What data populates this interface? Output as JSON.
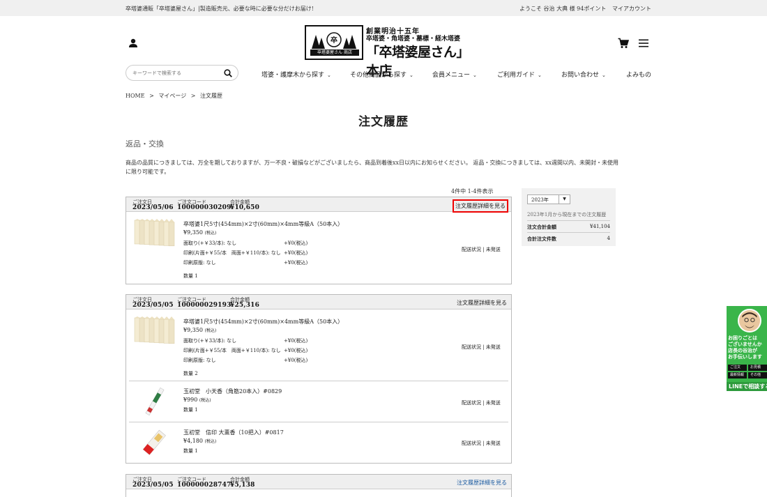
{
  "topbar": {
    "message": "卒塔婆通販「卒塔婆屋さん」|製造販売元、必要な時に必要な分だけお届け!",
    "welcome": "ようこそ 谷治 大典 様 94ポイント",
    "my_account": "マイアカウント"
  },
  "logo": {
    "seal_band": "卒塔婆屋さん 商店",
    "line1": "創業明治十五年",
    "line2": "卒塔婆・角塔婆・墓標・経木塔婆",
    "line3": "「卒塔婆屋さん」本店"
  },
  "icons": {
    "user": "user-icon",
    "cart": "cart-icon",
    "menu": "menu-icon",
    "search": "search-icon"
  },
  "search": {
    "placeholder": "キーワードで検索する"
  },
  "nav": [
    {
      "label": "塔婆・護摩木から探す",
      "chevron": "⌄"
    },
    {
      "label": "その他商品から探す",
      "chevron": "⌄"
    },
    {
      "label": "会員メニュー",
      "chevron": "⌄"
    },
    {
      "label": "ご利用ガイド",
      "chevron": "⌄"
    },
    {
      "label": "お問い合わせ",
      "chevron": "⌄"
    },
    {
      "label": "よみもの"
    }
  ],
  "breadcrumb": {
    "items": [
      "HOME",
      "マイページ",
      "注文履歴"
    ],
    "sep": ">"
  },
  "page_title": "注文履歴",
  "section_title": "返品・交換",
  "notice": "商品の品質につきましては、万全を期しておりますが、万一不良・破損などがございましたら、商品到着後xx日以内にお知らせください。 返品・交換につきましては、xx週間以内、未開封・未使用に限り可能です。",
  "count_text": "4件中 1-4件表示",
  "labels": {
    "order_date": "ご注文日",
    "order_code": "ご注文コード",
    "total": "合計金額",
    "detail_link": "注文履歴詳細を見る",
    "ship_status": "配送状況 | 未発送"
  },
  "orders": [
    {
      "date": "2023/05/06",
      "code": "100000030209",
      "total": "¥10,650",
      "items": [
        {
          "name": "卒塔婆1尺5寸(454mm)×2寸(60mm)×4mm等級A（50本入）",
          "price": "¥9,350",
          "tax": "(税込)",
          "options": [
            {
              "label": "面取り(+￥33/本): なし",
              "value": "+¥0(税込)"
            },
            {
              "label": "印刷(片面+￥55/本　両面+￥110/本): なし",
              "value": "+¥0(税込)"
            },
            {
              "label": "印刷原版: なし",
              "value": "+¥0(税込)"
            }
          ],
          "qty": "数量 1"
        }
      ]
    },
    {
      "date": "2023/05/05",
      "code": "100000029193",
      "total": "¥25,316",
      "items": [
        {
          "name": "卒塔婆1尺5寸(454mm)×2寸(60mm)×4mm等級A（50本入）",
          "price": "¥9,350",
          "tax": "(税込)",
          "options": [
            {
              "label": "面取り(+￥33/本): なし",
              "value": "+¥0(税込)"
            },
            {
              "label": "印刷(片面+￥55/本　両面+￥110/本): なし",
              "value": "+¥0(税込)"
            },
            {
              "label": "印刷原版: なし",
              "value": "+¥0(税込)"
            }
          ],
          "qty": "数量 2"
        },
        {
          "name": "玉初堂　小天香（角筋20本入）#0829",
          "price": "¥990",
          "tax": "(税込)",
          "options": [],
          "qty": "数量 1"
        },
        {
          "name": "玉初堂　信印 大薫香（10把入）#0817",
          "price": "¥4,180",
          "tax": "(税込)",
          "options": [],
          "qty": "数量 1"
        }
      ]
    },
    {
      "date": "2023/05/05",
      "code": "100000028747",
      "total": "¥5,138",
      "items": []
    }
  ],
  "side": {
    "year": "2023年",
    "arrow": "▼",
    "note": "2023年1月から現在までの注文履歴",
    "total_label": "注文合計金額",
    "total_value": "¥41,104",
    "count_label": "合計注文件数",
    "count_value": "4"
  },
  "line_banner": {
    "text1": "お困りごとは",
    "text2": "ございませんか",
    "text3": "店長の谷治が",
    "text4": "お手伝いします",
    "btn1": "ご注文",
    "btn2": "お見積",
    "btn3": "最新情報",
    "btn4": "その他",
    "footer": "LINEで相談する"
  },
  "colors": {
    "highlight": "#e00000",
    "link_blue": "#1a5aa0",
    "line_green": "#3ab54a"
  }
}
